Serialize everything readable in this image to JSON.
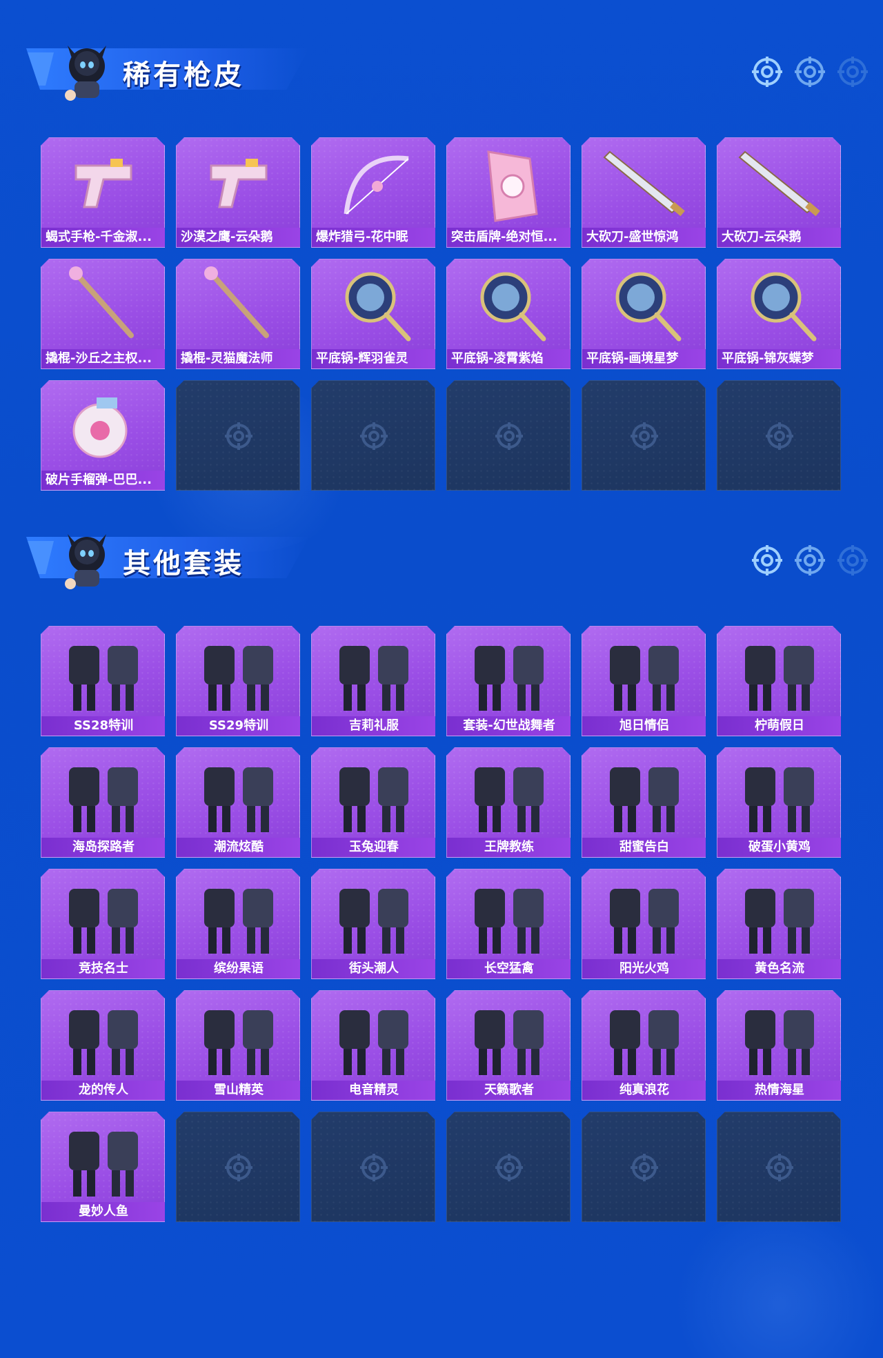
{
  "sections": [
    {
      "title": "稀有枪皮",
      "items": [
        {
          "label": "蝎式手枪-千金淑...",
          "icon": "pistol-icon"
        },
        {
          "label": "沙漠之鹰-云朵鹅",
          "icon": "pistol-icon"
        },
        {
          "label": "爆炸猎弓-花中眠",
          "icon": "bow-icon"
        },
        {
          "label": "突击盾牌-绝对恒...",
          "icon": "shield-icon"
        },
        {
          "label": "大砍刀-盛世惊鸿",
          "icon": "machete-icon"
        },
        {
          "label": "大砍刀-云朵鹅",
          "icon": "machete-icon"
        },
        {
          "label": "撬棍-沙丘之主权...",
          "icon": "crowbar-icon"
        },
        {
          "label": "撬棍-灵猫魔法师",
          "icon": "crowbar-icon"
        },
        {
          "label": "平底锅-辉羽雀灵",
          "icon": "pan-icon"
        },
        {
          "label": "平底锅-凌霄紫焰",
          "icon": "pan-icon"
        },
        {
          "label": "平底锅-画境星梦",
          "icon": "pan-icon"
        },
        {
          "label": "平底锅-锦灰蝶梦",
          "icon": "pan-icon"
        },
        {
          "label": "破片手榴弹-巴巴...",
          "icon": "grenade-icon"
        }
      ]
    },
    {
      "title": "其他套装",
      "items": [
        {
          "label": "SS28特训",
          "icon": "outfit-icon"
        },
        {
          "label": "SS29特训",
          "icon": "outfit-icon"
        },
        {
          "label": "吉莉礼服",
          "icon": "outfit-icon"
        },
        {
          "label": "套装-幻世战舞者",
          "icon": "outfit-icon"
        },
        {
          "label": "旭日情侣",
          "icon": "outfit-icon"
        },
        {
          "label": "柠萌假日",
          "icon": "outfit-icon"
        },
        {
          "label": "海岛探路者",
          "icon": "outfit-icon"
        },
        {
          "label": "潮流炫酷",
          "icon": "outfit-icon"
        },
        {
          "label": "玉兔迎春",
          "icon": "outfit-icon"
        },
        {
          "label": "王牌教练",
          "icon": "outfit-icon"
        },
        {
          "label": "甜蜜告白",
          "icon": "outfit-icon"
        },
        {
          "label": "破蛋小黄鸡",
          "icon": "outfit-icon"
        },
        {
          "label": "竞技名士",
          "icon": "outfit-icon"
        },
        {
          "label": "缤纷果语",
          "icon": "outfit-icon"
        },
        {
          "label": "街头潮人",
          "icon": "outfit-icon"
        },
        {
          "label": "长空猛禽",
          "icon": "outfit-icon"
        },
        {
          "label": "阳光火鸡",
          "icon": "outfit-icon"
        },
        {
          "label": "黄色名流",
          "icon": "outfit-icon"
        },
        {
          "label": "龙的传人",
          "icon": "outfit-icon"
        },
        {
          "label": "雪山精英",
          "icon": "outfit-icon"
        },
        {
          "label": "电音精灵",
          "icon": "outfit-icon"
        },
        {
          "label": "天籁歌者",
          "icon": "outfit-icon"
        },
        {
          "label": "纯真浪花",
          "icon": "outfit-icon"
        },
        {
          "label": "热情海星",
          "icon": "outfit-icon"
        },
        {
          "label": "曼妙人鱼",
          "icon": "outfit-icon"
        }
      ]
    }
  ],
  "colors": {
    "background": "#0b4fd0",
    "card_fill": "#9b4fe6",
    "card_label": "#7a2fd0",
    "empty_card": "#1f3862",
    "accent_light": "#8fc4ff"
  }
}
